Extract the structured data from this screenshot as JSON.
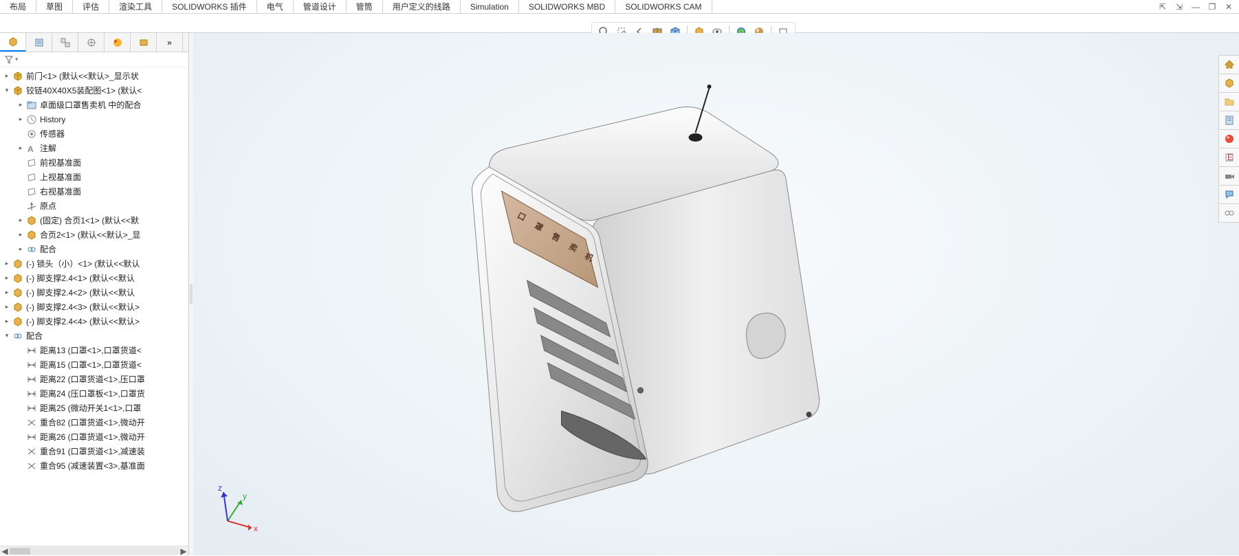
{
  "ribbon": {
    "tabs": [
      "布局",
      "草图",
      "评估",
      "渲染工具",
      "SOLIDWORKS 插件",
      "电气",
      "管道设计",
      "管筒",
      "用户定义的线路",
      "Simulation",
      "SOLIDWORKS MBD",
      "SOLIDWORKS CAM"
    ]
  },
  "windowControls": {
    "collapse": "⇱",
    "expand": "⇲",
    "minimize": "—",
    "restore": "❐",
    "close": "✕"
  },
  "viewToolbar": {
    "zoom_fit": "zoom-fit-icon",
    "zoom_area": "zoom-area-icon",
    "previous_view": "prev-view-icon",
    "section_view": "section-view-icon",
    "view_orientation": "orient-icon",
    "display_style": "display-style-icon",
    "hide_show": "hide-show-icon",
    "edit_appearance": "appearance-icon",
    "apply_scene": "scene-icon",
    "view_settings": "settings-icon"
  },
  "treeTabs": {
    "feature_manager": "feature-manager-icon",
    "property_manager": "property-manager-icon",
    "configuration_manager": "config-manager-icon",
    "dimxpert": "dimxpert-icon",
    "display_manager": "display-manager-icon",
    "cam_manager": "cam-manager-icon",
    "expand": "»"
  },
  "filter": {
    "placeholder": ""
  },
  "tree": [
    {
      "indent": 1,
      "exp": "▸",
      "icon": "assembly",
      "label": "前门<1> (默认<<默认>_显示状"
    },
    {
      "indent": 1,
      "exp": "▾",
      "icon": "assembly",
      "label": "铰链40X40X5装配图<1> (默认<"
    },
    {
      "indent": 2,
      "exp": "▸",
      "icon": "mates-folder",
      "label": "卓面级口罩售卖机 中的配合"
    },
    {
      "indent": 2,
      "exp": "▸",
      "icon": "history",
      "label": "History"
    },
    {
      "indent": 2,
      "exp": "",
      "icon": "sensor",
      "label": "传感器"
    },
    {
      "indent": 2,
      "exp": "▸",
      "icon": "annotation",
      "label": "注解"
    },
    {
      "indent": 2,
      "exp": "",
      "icon": "plane",
      "label": "前视基准面"
    },
    {
      "indent": 2,
      "exp": "",
      "icon": "plane",
      "label": "上视基准面"
    },
    {
      "indent": 2,
      "exp": "",
      "icon": "plane",
      "label": "右视基准面"
    },
    {
      "indent": 2,
      "exp": "",
      "icon": "origin",
      "label": "原点"
    },
    {
      "indent": 2,
      "exp": "▸",
      "icon": "part",
      "label": "(固定) 合页1<1> (默认<<默"
    },
    {
      "indent": 2,
      "exp": "▸",
      "icon": "part",
      "label": "合页2<1> (默认<<默认>_显"
    },
    {
      "indent": 2,
      "exp": "▸",
      "icon": "mates",
      "label": "配合"
    },
    {
      "indent": 1,
      "exp": "▸",
      "icon": "part",
      "label": "(-) 锁头（小）<1> (默认<<默认"
    },
    {
      "indent": 1,
      "exp": "▸",
      "icon": "part",
      "label": "(-) 脚支撑2.4<1> (默认<<默认"
    },
    {
      "indent": 1,
      "exp": "▸",
      "icon": "part",
      "label": "(-) 脚支撑2.4<2> (默认<<默认"
    },
    {
      "indent": 1,
      "exp": "▸",
      "icon": "part",
      "label": "(-) 脚支撑2.4<3> (默认<<默认>"
    },
    {
      "indent": 1,
      "exp": "▸",
      "icon": "part",
      "label": "(-) 脚支撑2.4<4> (默认<<默认>"
    },
    {
      "indent": 1,
      "exp": "▾",
      "icon": "mates",
      "label": "配合"
    },
    {
      "indent": 2,
      "exp": "",
      "icon": "distance",
      "label": "距离13 (口罩<1>,口罩货道<"
    },
    {
      "indent": 2,
      "exp": "",
      "icon": "distance",
      "label": "距离15 (口罩<1>,口罩货道<"
    },
    {
      "indent": 2,
      "exp": "",
      "icon": "distance",
      "label": "距离22 (口罩货道<1>,压口罩"
    },
    {
      "indent": 2,
      "exp": "",
      "icon": "distance",
      "label": "距离24 (压口罩板<1>,口罩货"
    },
    {
      "indent": 2,
      "exp": "",
      "icon": "distance",
      "label": "距离25 (微动开关1<1>,口罩"
    },
    {
      "indent": 2,
      "exp": "",
      "icon": "coincident",
      "label": "重合82 (口罩货道<1>,微动开"
    },
    {
      "indent": 2,
      "exp": "",
      "icon": "distance",
      "label": "距离26 (口罩货道<1>,微动开"
    },
    {
      "indent": 2,
      "exp": "",
      "icon": "coincident",
      "label": "重合91 (口罩货道<1>,减速装"
    },
    {
      "indent": 2,
      "exp": "",
      "icon": "coincident",
      "label": "重合95 (减速装置<3>,基准面"
    }
  ],
  "rightPanel": {
    "items": [
      "home-icon",
      "assembly-icon",
      "folder-icon",
      "properties-icon",
      "appearance-icon",
      "decals-icon",
      "camera-icon",
      "forum-icon",
      "motion-icon"
    ]
  },
  "model": {
    "label_chars": [
      "口",
      "罩",
      "售",
      "卖",
      "机"
    ]
  },
  "triad": {
    "x": "x",
    "y": "y",
    "z": "z"
  }
}
